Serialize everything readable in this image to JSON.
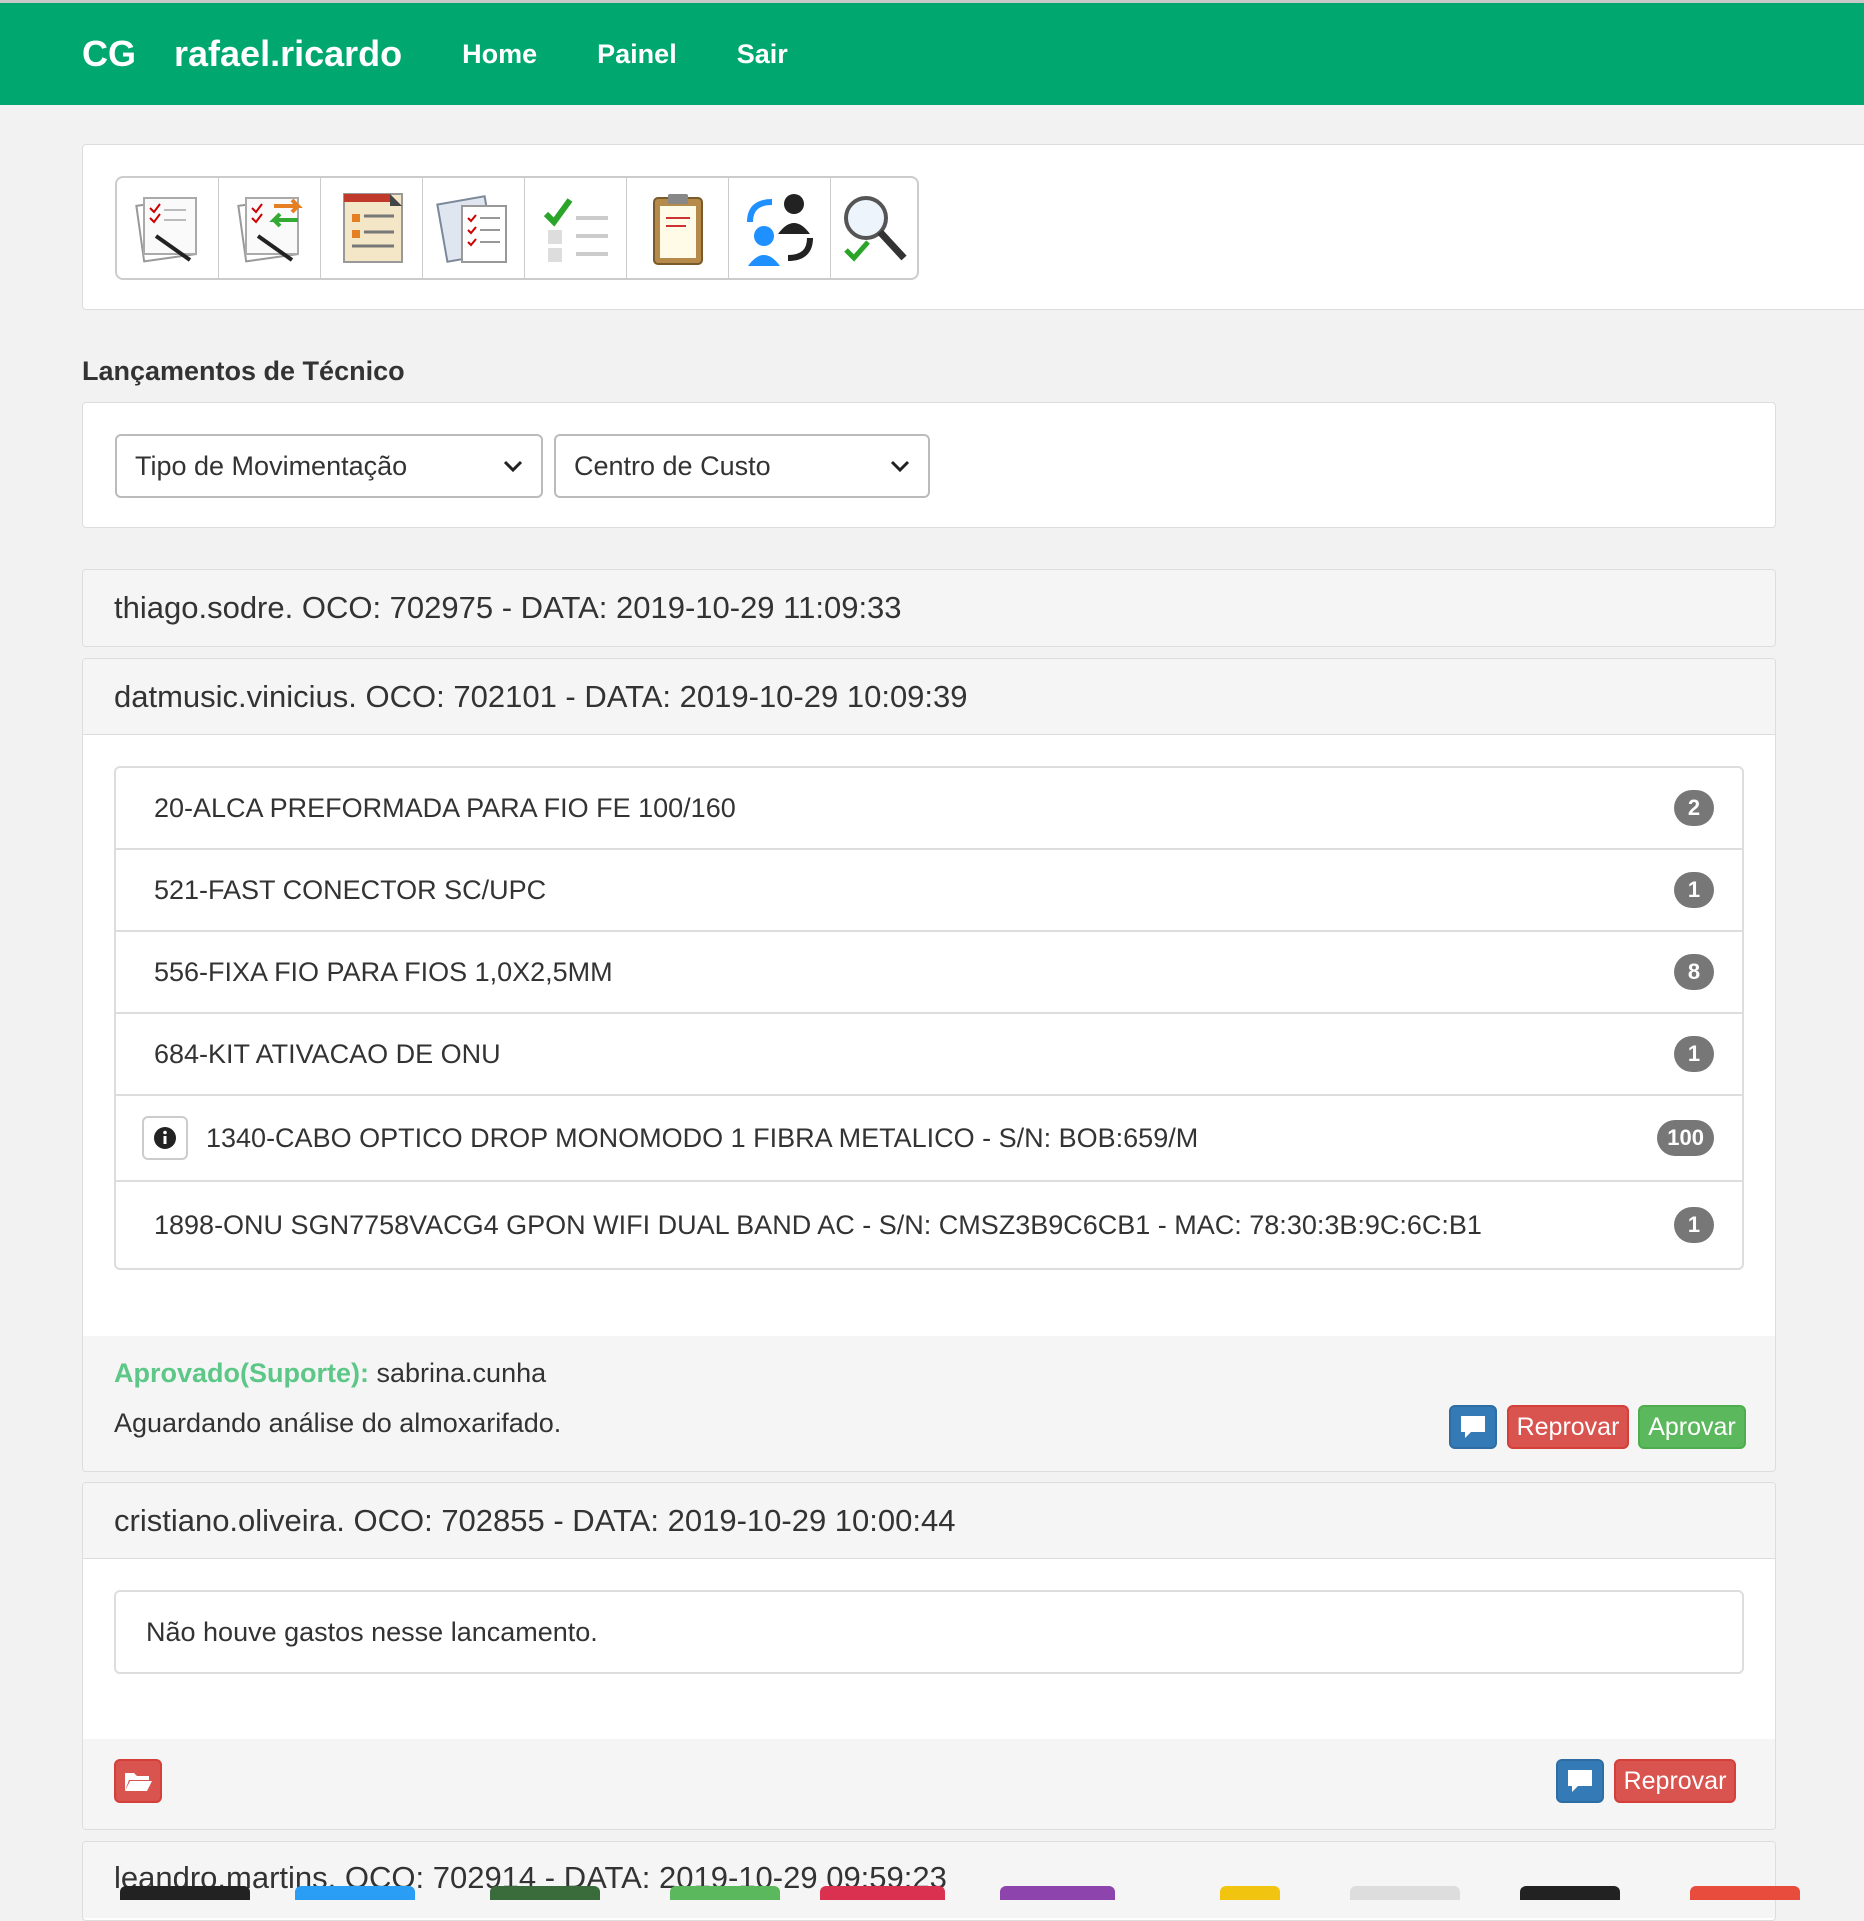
{
  "navbar": {
    "brand_short": "CG",
    "username": "rafael.ricardo",
    "links": [
      "Home",
      "Painel",
      "Sair"
    ]
  },
  "toolbar": {
    "tools": [
      "checklist-pen-icon",
      "checklist-transfer-icon",
      "report-document-icon",
      "documents-list-icon",
      "checklist-icon",
      "clipboard-icon",
      "user-swap-icon",
      "search-approve-icon"
    ]
  },
  "page": {
    "section_title": "Lançamentos de Técnico"
  },
  "filters": {
    "tipo_movimentacao": "Tipo de Movimentação",
    "centro_custo": "Centro de Custo"
  },
  "entries": [
    {
      "header": "thiago.sodre. OCO: 702975 - DATA: 2019-10-29 11:09:33"
    },
    {
      "header": "datmusic.vinicius. OCO: 702101 - DATA: 2019-10-29 10:09:39",
      "items": [
        {
          "text": "20-ALCA PREFORMADA PARA FIO FE 100/160",
          "qty": "2"
        },
        {
          "text": "521-FAST CONECTOR SC/UPC",
          "qty": "1"
        },
        {
          "text": "556-FIXA FIO PARA FIOS 1,0X2,5MM",
          "qty": "8"
        },
        {
          "text": "684-KIT ATIVACAO DE ONU",
          "qty": "1"
        },
        {
          "text": "1340-CABO OPTICO DROP MONOMODO 1 FIBRA METALICO - S/N: BOB:659/M",
          "qty": "100"
        },
        {
          "text": "1898-ONU SGN7758VACG4 GPON WIFI DUAL BAND AC - S/N: CMSZ3B9C6CB1 - MAC: 78:30:3B:9C:6C:B1",
          "qty": "1"
        }
      ],
      "approved_label": "Aprovado(Suporte):",
      "approved_by": "sabrina.cunha",
      "status": "Aguardando análise do almoxarifado.",
      "btn_reprovar": "Reprovar",
      "btn_aprovar": "Aprovar"
    },
    {
      "header": "cristiano.oliveira. OCO: 702855 - DATA: 2019-10-29 10:00:44",
      "empty_message": "Não houve gastos nesse lancamento.",
      "btn_reprovar": "Reprovar"
    },
    {
      "header": "leandro.martins. OCO: 702914 - DATA: 2019-10-29 09:59:23"
    }
  ],
  "colors": {
    "navbar": "#00a86f",
    "approved": "#5cc787",
    "danger": "#d9534f",
    "success": "#5cb85c",
    "primary": "#337ab7"
  }
}
